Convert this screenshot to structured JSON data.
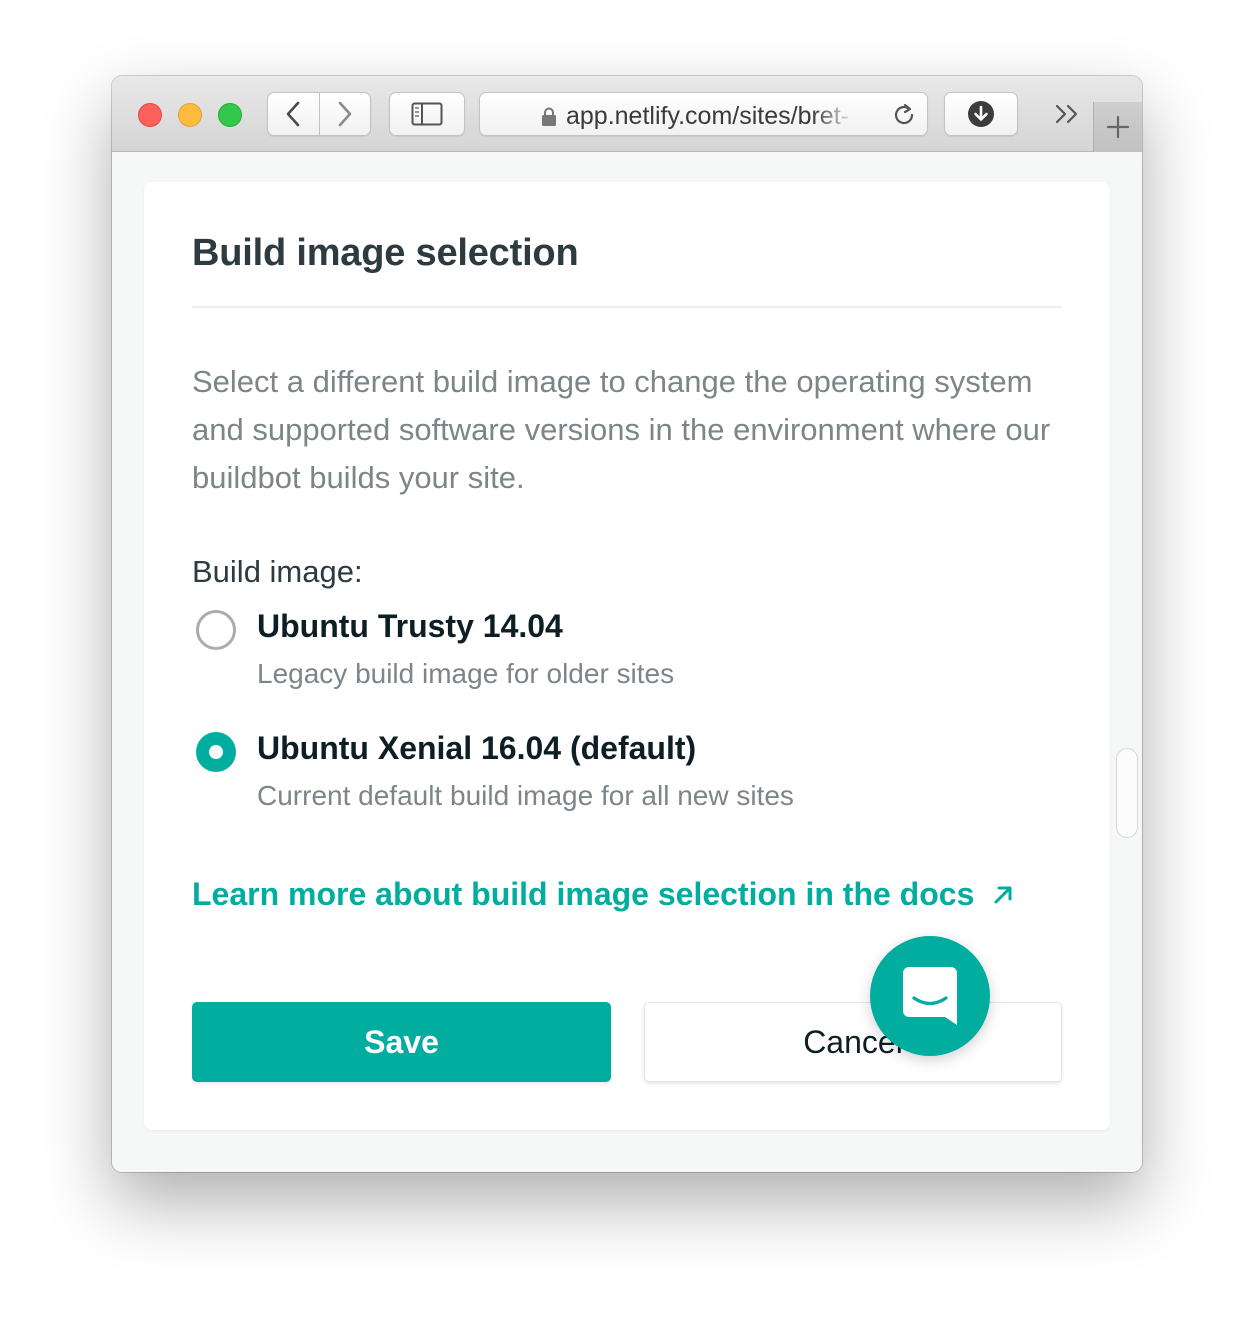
{
  "browser": {
    "url": "app.netlify.com/sites/bret-",
    "icons": {
      "back": "chevron-left-icon",
      "forward": "chevron-right-icon",
      "sidebar": "sidebar-icon",
      "lock": "lock-icon",
      "reload": "reload-icon",
      "download": "download-icon",
      "overflow": "double-chevron-icon",
      "new_tab": "plus-icon"
    }
  },
  "card": {
    "title": "Build image selection",
    "description": "Select a different build image to change the operating system and supported software versions in the environment where our buildbot builds your site.",
    "field_label": "Build image:",
    "options": [
      {
        "title": "Ubuntu Trusty 14.04",
        "description": "Legacy build image for older sites",
        "selected": false
      },
      {
        "title": "Ubuntu Xenial 16.04 (default)",
        "description": "Current default build image for all new sites",
        "selected": true
      }
    ],
    "docs_link": "Learn more about build image selection in the docs",
    "save_label": "Save",
    "cancel_label": "Cancel"
  },
  "colors": {
    "accent": "#00ad9f",
    "heading": "#2d3b41",
    "muted": "#7d8589"
  }
}
